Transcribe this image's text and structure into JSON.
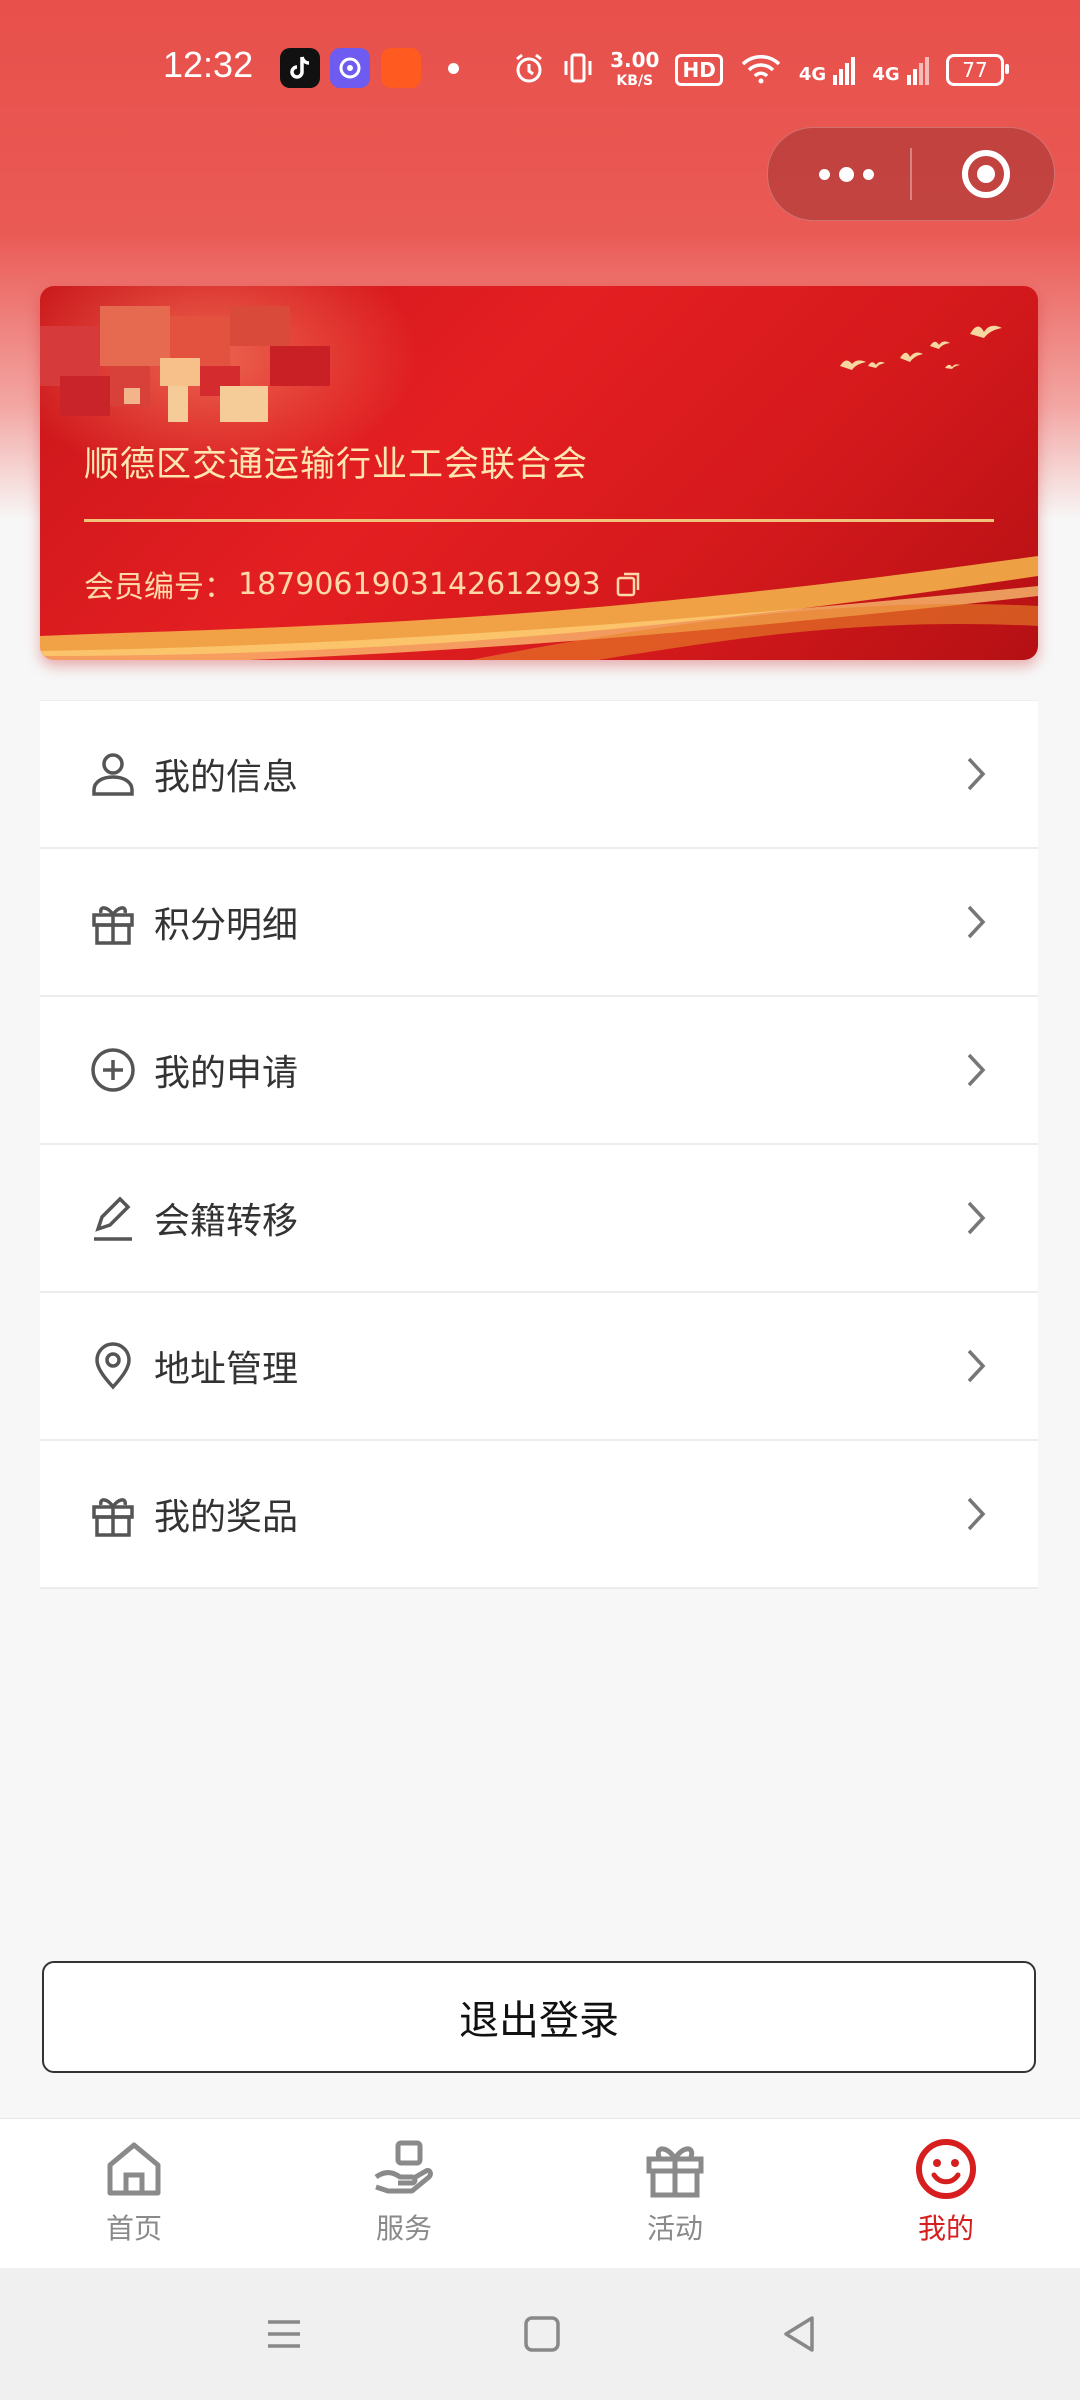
{
  "status_bar": {
    "time": "12:32",
    "net_speed_value": "3.00",
    "net_speed_unit": "KB/S",
    "hd_label": "HD",
    "net_type_1": "4G",
    "net_type_2": "4G",
    "battery": "77"
  },
  "capsule": {
    "more_icon": "more-dots-icon",
    "close_icon": "target-close-icon"
  },
  "card": {
    "org_name": "顺德区交通运输行业工会联合会",
    "member_id_label": "会员编号：",
    "member_id": "1879061903142612993",
    "copy_icon": "copy-icon"
  },
  "menu": [
    {
      "label": "我的信息",
      "icon": "user-icon"
    },
    {
      "label": "积分明细",
      "icon": "gift-icon"
    },
    {
      "label": "我的申请",
      "icon": "plus-circle-icon"
    },
    {
      "label": "会籍转移",
      "icon": "edit-icon"
    },
    {
      "label": "地址管理",
      "icon": "location-pin-icon"
    },
    {
      "label": "我的奖品",
      "icon": "gift-icon"
    }
  ],
  "logout_label": "退出登录",
  "tabbar": {
    "tabs": [
      {
        "label": "首页",
        "icon": "home-icon"
      },
      {
        "label": "服务",
        "icon": "hand-service-icon"
      },
      {
        "label": "活动",
        "icon": "gift-box-icon"
      },
      {
        "label": "我的",
        "icon": "smiley-icon"
      }
    ],
    "active_index": 3
  },
  "colors": {
    "accent": "#d71e1e",
    "card_text": "#ffe6b0"
  }
}
